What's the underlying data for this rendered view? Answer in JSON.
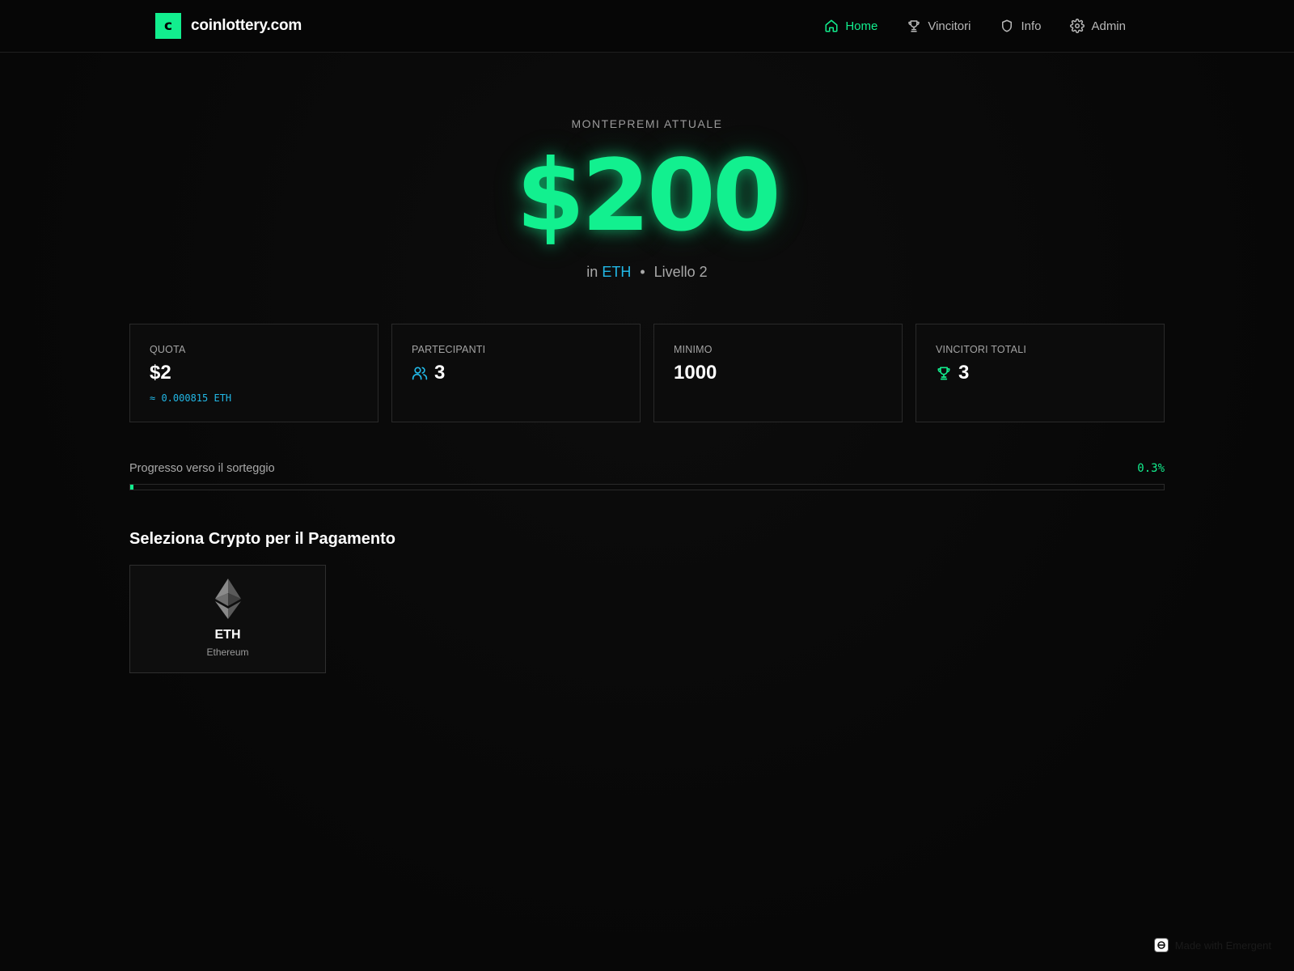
{
  "header": {
    "logo_letter": "c",
    "site_name": "coinlottery.com",
    "nav": [
      {
        "label": "Home",
        "icon": "home-icon",
        "active": true
      },
      {
        "label": "Vincitori",
        "icon": "trophy-icon",
        "active": false
      },
      {
        "label": "Info",
        "icon": "shield-icon",
        "active": false
      },
      {
        "label": "Admin",
        "icon": "gear-icon",
        "active": false
      }
    ]
  },
  "hero": {
    "label": "MONTEPREMI ATTUALE",
    "amount": "$200",
    "prefix": "in",
    "coin": "ETH",
    "separator": "•",
    "level": "Livello 2"
  },
  "stats": {
    "quota": {
      "label": "QUOTA",
      "value": "$2",
      "note": "≈ 0.000815 ETH"
    },
    "partecipanti": {
      "label": "PARTECIPANTI",
      "value": "3",
      "icon": "users-icon"
    },
    "minimo": {
      "label": "MINIMO",
      "value": "1000"
    },
    "vincitori": {
      "label": "VINCITORI TOTALI",
      "value": "3",
      "icon": "trophy-icon"
    }
  },
  "progress": {
    "label": "Progresso verso il sorteggio",
    "percent_text": "0.3%",
    "fraction": 0.003
  },
  "crypto_section": {
    "title": "Seleziona Crypto per il Pagamento",
    "options": [
      {
        "symbol": "ETH",
        "name": "Ethereum",
        "icon": "ethereum-icon"
      }
    ]
  },
  "footer": {
    "badge_text": "Made with Emergent"
  },
  "colors": {
    "accent": "#12ee8e",
    "coin": "#22b8e6",
    "background": "#080808",
    "card_border": "#2a2a2a"
  }
}
